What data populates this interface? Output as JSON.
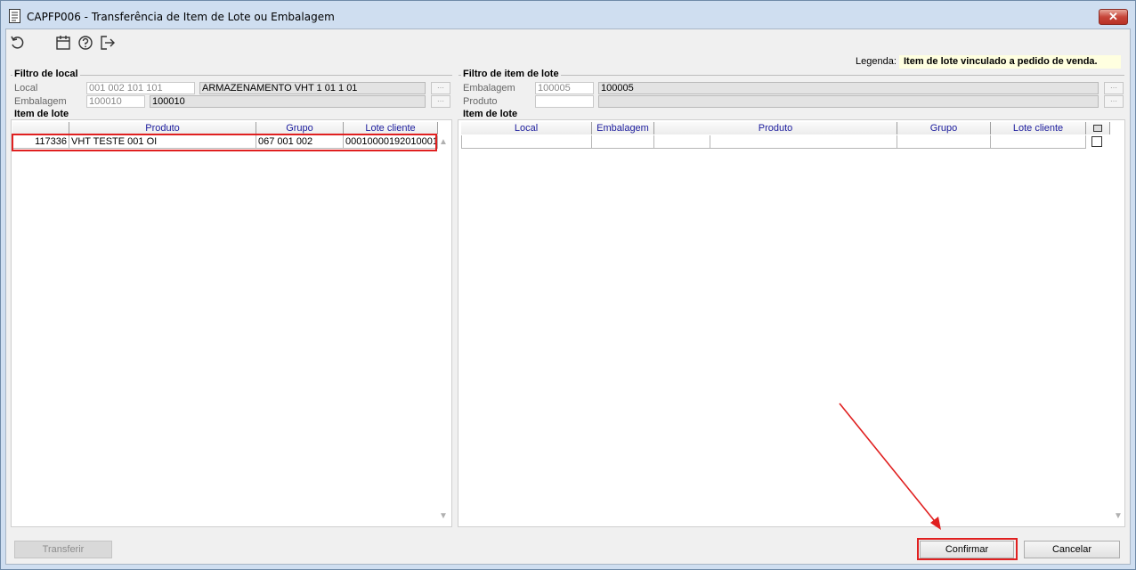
{
  "window": {
    "title": "CAPFP006 - Transferência de Item de Lote ou Embalagem",
    "close_symbol": "✕"
  },
  "toolbar": {
    "icons": [
      "refresh-icon",
      "calendar-icon",
      "help-icon",
      "exit-icon"
    ]
  },
  "legend": {
    "label": "Legenda:",
    "value": "Item de lote vinculado a pedido de venda."
  },
  "left": {
    "filter_title": "Filtro de local",
    "local_label": "Local",
    "local_code": "001 002 101 101",
    "local_desc": "ARMAZENAMENTO VHT 1 01 1 01",
    "embalagem_label": "Embalagem",
    "embalagem_code": "100010",
    "embalagem_desc": "100010",
    "grid_title": "Item de lote",
    "columns": [
      "Produto",
      "Grupo",
      "Lote cliente"
    ],
    "rows": [
      {
        "code": "117336",
        "produto": "VHT TESTE 001 OI",
        "grupo": "067 001 002",
        "lote": "00010000192010001"
      }
    ]
  },
  "right": {
    "filter_title": "Filtro de item de lote",
    "embalagem_label": "Embalagem",
    "embalagem_code": "100005",
    "embalagem_desc": "100005",
    "produto_label": "Produto",
    "grid_title": "Item de lote",
    "columns": [
      "Local",
      "Embalagem",
      "Produto",
      "Grupo",
      "Lote cliente"
    ]
  },
  "buttons": {
    "transferir": "Transferir",
    "confirmar": "Confirmar",
    "cancelar": "Cancelar"
  }
}
